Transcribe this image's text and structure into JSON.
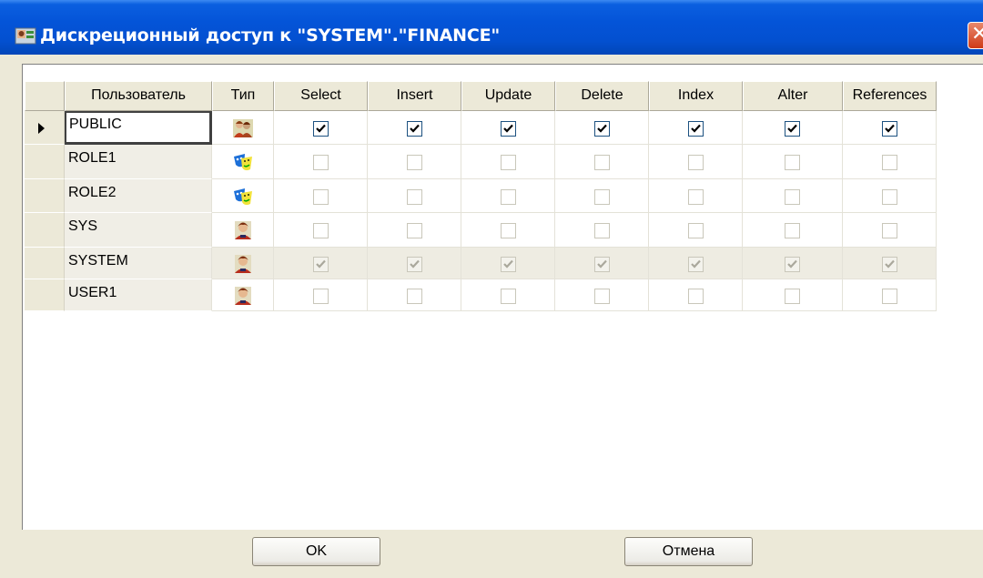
{
  "window": {
    "title": "Дискреционный доступ к \"SYSTEM\".\"FINANCE\"",
    "title_color": "#ffffff",
    "titlebar_color": "#0454d8",
    "close_glyph": "✕"
  },
  "grid": {
    "columns": [
      "Пользователь",
      "Тип",
      "Select",
      "Insert",
      "Update",
      "Delete",
      "Index",
      "Alter",
      "References"
    ],
    "rows": [
      {
        "name": "PUBLIC",
        "type_icon": "public-group-icon",
        "current": true,
        "disabled": false,
        "perms": [
          true,
          true,
          true,
          true,
          true,
          true,
          true
        ]
      },
      {
        "name": "ROLE1",
        "type_icon": "role-icon",
        "current": false,
        "disabled": false,
        "perms": [
          false,
          false,
          false,
          false,
          false,
          false,
          false
        ]
      },
      {
        "name": "ROLE2",
        "type_icon": "role-icon",
        "current": false,
        "disabled": false,
        "perms": [
          false,
          false,
          false,
          false,
          false,
          false,
          false
        ]
      },
      {
        "name": "SYS",
        "type_icon": "user-icon",
        "current": false,
        "disabled": false,
        "perms": [
          false,
          false,
          false,
          false,
          false,
          false,
          false
        ]
      },
      {
        "name": "SYSTEM",
        "type_icon": "user-icon",
        "current": false,
        "disabled": true,
        "perms": [
          true,
          true,
          true,
          true,
          true,
          true,
          true
        ]
      },
      {
        "name": "USER1",
        "type_icon": "user-icon",
        "current": false,
        "disabled": false,
        "perms": [
          false,
          false,
          false,
          false,
          false,
          false,
          false
        ]
      }
    ]
  },
  "buttons": {
    "ok": "OK",
    "cancel": "Отмена"
  }
}
